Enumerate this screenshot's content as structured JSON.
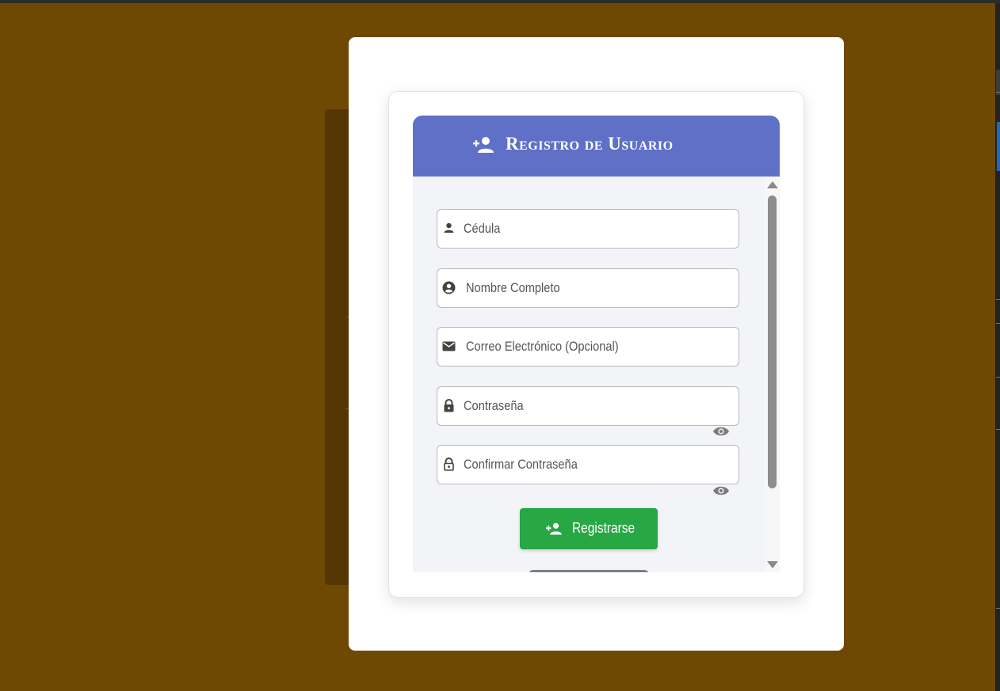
{
  "dialog": {
    "title": "Registro de Usuario",
    "header_icon": "person-add-icon",
    "header_color": "#5f70c6"
  },
  "form": {
    "fields": [
      {
        "placeholder": "Cédula",
        "icon": "person-icon"
      },
      {
        "placeholder": "Nombre Completo",
        "icon": "account-circle-icon"
      },
      {
        "placeholder": "Correo Electrónico (Opcional)",
        "icon": "mail-icon"
      },
      {
        "placeholder": "Contraseña",
        "icon": "lock-icon",
        "toggle_icon": "eye-icon"
      },
      {
        "placeholder": "Confirmar Contraseña",
        "icon": "lock-open-icon",
        "toggle_icon": "eye-icon"
      }
    ],
    "submit": {
      "label": "Registrarse",
      "icon": "person-add-icon",
      "color": "#28a745"
    }
  },
  "colors": {
    "page_background": "#6f4903",
    "card_body": "#f3f4f8"
  }
}
